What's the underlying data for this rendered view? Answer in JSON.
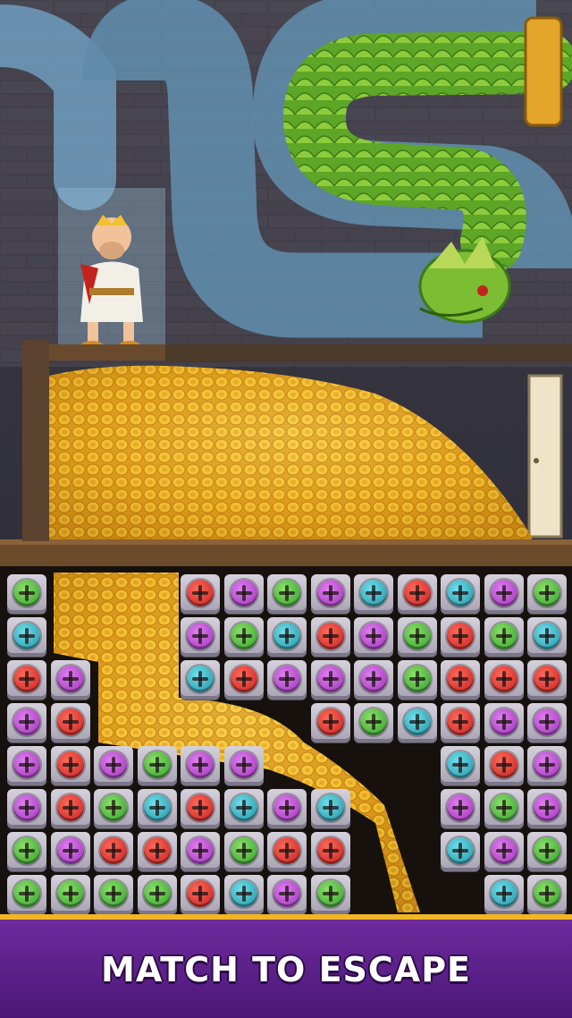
{
  "banner": {
    "text": "MATCH TO ESCAPE"
  },
  "colors": {
    "green": "#2f9a2a",
    "red": "#c31d1d",
    "purple": "#9a2fb5",
    "teal": "#1f8ea0",
    "banner": "#5a2088",
    "gold": "#f0b722"
  },
  "board": {
    "rows": [
      [
        "green",
        null,
        null,
        null,
        "red",
        "purple",
        "green",
        "purple",
        "teal",
        "red",
        "teal",
        "purple",
        "green"
      ],
      [
        "teal",
        null,
        null,
        null,
        "purple",
        "green",
        "teal",
        "red",
        "purple",
        "green",
        "red",
        "green",
        "teal"
      ],
      [
        "red",
        "purple",
        null,
        null,
        "teal",
        "red",
        "purple",
        "purple",
        "purple",
        "green",
        "red",
        "red",
        "red"
      ],
      [
        "purple",
        "red",
        null,
        null,
        null,
        null,
        null,
        "red",
        "green",
        "teal",
        "red",
        "purple",
        "purple"
      ],
      [
        "purple",
        "red",
        "purple",
        "green",
        "purple",
        "purple",
        null,
        null,
        null,
        null,
        "teal",
        "red",
        "purple"
      ],
      [
        "purple",
        "red",
        "green",
        "teal",
        "red",
        "teal",
        "purple",
        "teal",
        null,
        null,
        "purple",
        "green",
        "purple"
      ],
      [
        "green",
        "purple",
        "red",
        "red",
        "purple",
        "green",
        "red",
        "red",
        null,
        null,
        "teal",
        "purple",
        "green"
      ],
      [
        "green",
        "green",
        "green",
        "green",
        "red",
        "teal",
        "purple",
        "green",
        null,
        null,
        null,
        "teal",
        "green"
      ]
    ]
  }
}
